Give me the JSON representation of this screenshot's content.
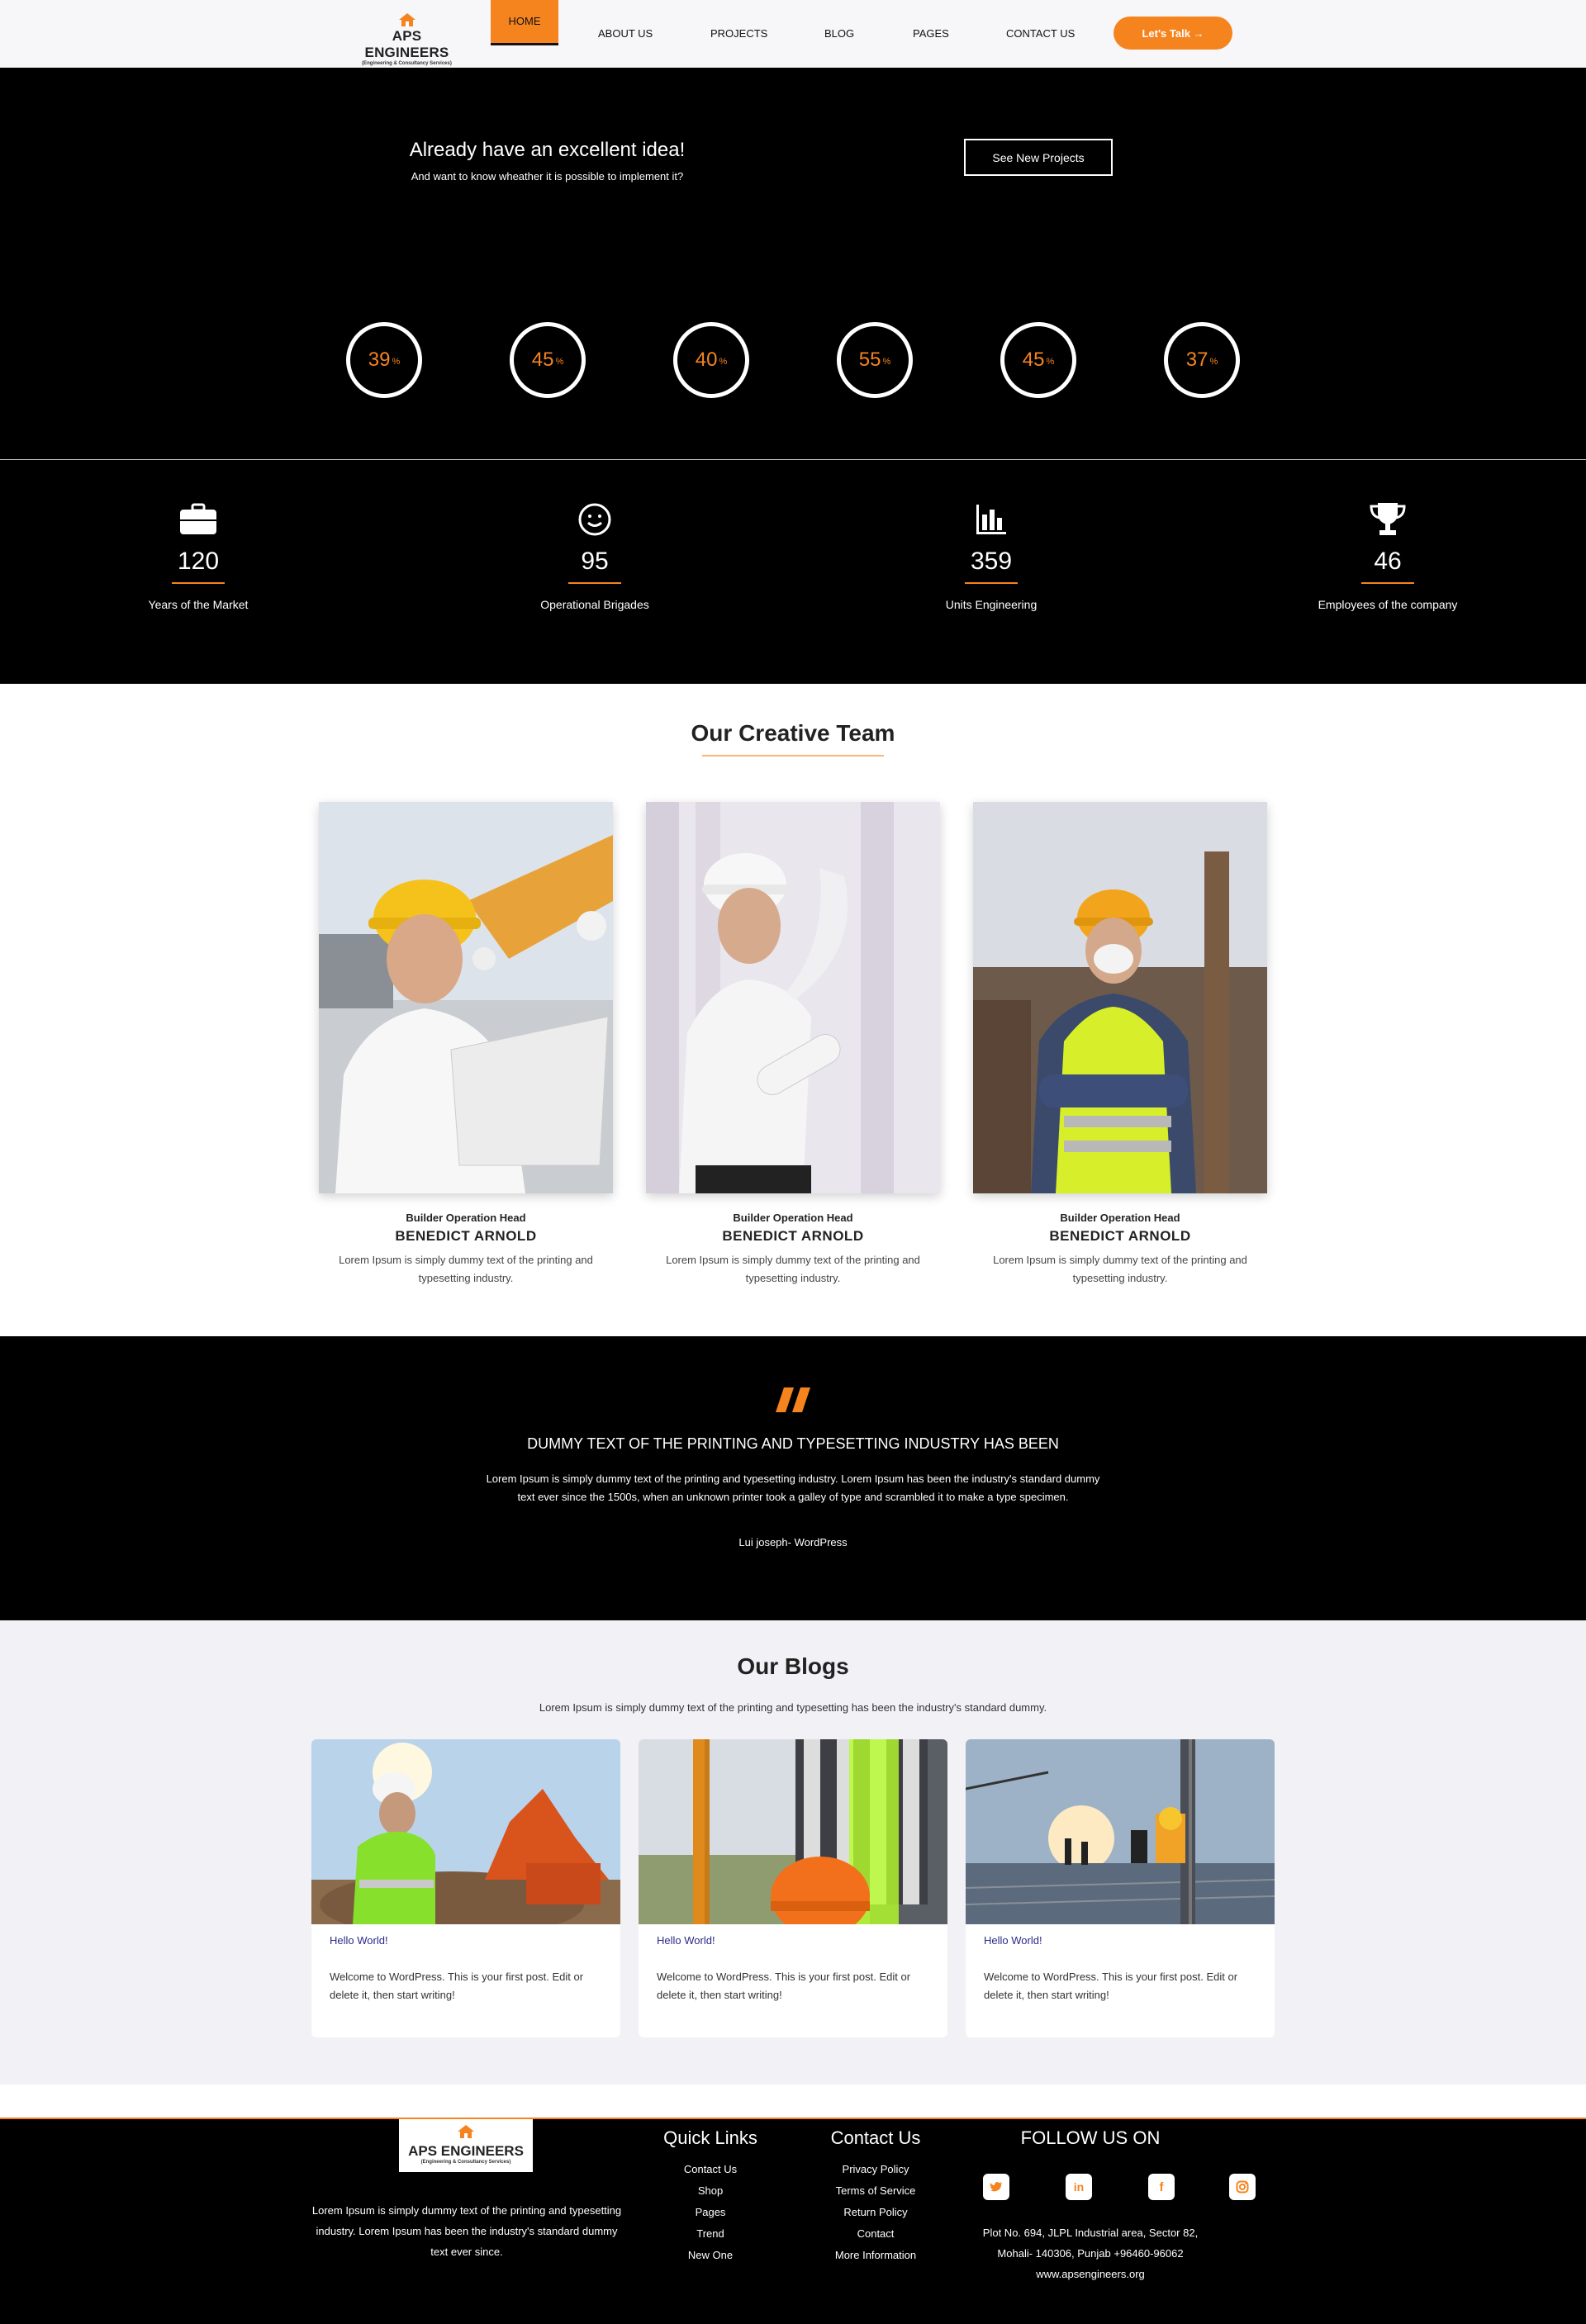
{
  "header": {
    "brand": "APS ENGINEERS",
    "tagline": "(Engineering & Consultancy Services)",
    "nav": [
      "HOME",
      "ABOUT US",
      "PROJECTS",
      "BLOG",
      "PAGES",
      "CONTACT US"
    ],
    "cta": "Let's Talk →"
  },
  "hero": {
    "title": "Already have an excellent idea!",
    "subtitle": "And want to know wheather it is possible to implement it?",
    "button": "See New Projects",
    "percents": [
      "39",
      "45",
      "40",
      "55",
      "45",
      "37"
    ],
    "pct_sign": "%"
  },
  "stats": [
    {
      "icon": "briefcase-icon",
      "value": "120",
      "label": "Years of the Market"
    },
    {
      "icon": "smiley-icon",
      "value": "95",
      "label": "Operational Brigades"
    },
    {
      "icon": "bar-chart-icon",
      "value": "359",
      "label": "Units Engineering"
    },
    {
      "icon": "trophy-icon",
      "value": "46",
      "label": "Employees of the company"
    }
  ],
  "team": {
    "title": "Our Creative Team",
    "members": [
      {
        "role": "Builder Operation Head",
        "name": "BENEDICT ARNOLD",
        "desc": "Lorem Ipsum is simply dummy text of the printing and typesetting industry."
      },
      {
        "role": "Builder Operation Head",
        "name": "BENEDICT ARNOLD",
        "desc": "Lorem Ipsum is simply dummy text of the printing and typesetting industry."
      },
      {
        "role": "Builder Operation Head",
        "name": "BENEDICT ARNOLD",
        "desc": "Lorem Ipsum is simply dummy text of the printing and typesetting industry."
      }
    ]
  },
  "testimonial": {
    "title": "DUMMY TEXT OF THE PRINTING AND TYPESETTING INDUSTRY HAS BEEN",
    "text": "Lorem Ipsum is simply dummy text of the printing and typesetting industry. Lorem Ipsum has been the industry's standard dummy text ever since the 1500s, when an unknown printer took a galley of type and scrambled it to make a type specimen.",
    "author": "Lui joseph- WordPress"
  },
  "blogs": {
    "title": "Our Blogs",
    "subtitle": "Lorem Ipsum is simply dummy text of the printing and typesetting has been the industry's standard dummy.",
    "posts": [
      {
        "title": "Hello World!",
        "body": "Welcome to WordPress. This is your first post. Edit or delete it, then start writing!"
      },
      {
        "title": "Hello World!",
        "body": "Welcome to WordPress. This is your first post. Edit or delete it, then start writing!"
      },
      {
        "title": "Hello World!",
        "body": "Welcome to WordPress. This is your first post. Edit or delete it, then start writing!"
      }
    ]
  },
  "footer": {
    "about": "Lorem Ipsum is simply dummy text of the printing and typesetting industry. Lorem Ipsum has been the industry's standard dummy text ever since.",
    "quick_links_title": "Quick Links",
    "quick_links": [
      "Contact Us",
      "Shop",
      "Pages",
      "Trend",
      "New One"
    ],
    "contact_title": "Contact Us",
    "contact_links": [
      "Privacy Policy",
      "Terms of Service",
      "Return Policy",
      "Contact",
      "More Information"
    ],
    "follow_title": "FOLLOW US ON",
    "social": [
      "twitter-icon",
      "linkedin-icon",
      "facebook-icon",
      "instagram-icon"
    ],
    "address_line1": "Plot No. 694, JLPL Industrial area, Sector 82,",
    "address_line2": "Mohali- 140306, Punjab +96460-96062",
    "website": "www.apsengineers.org"
  },
  "colors": {
    "accent": "#f5841f",
    "dark": "#000000",
    "link": "#2b2b8a"
  }
}
